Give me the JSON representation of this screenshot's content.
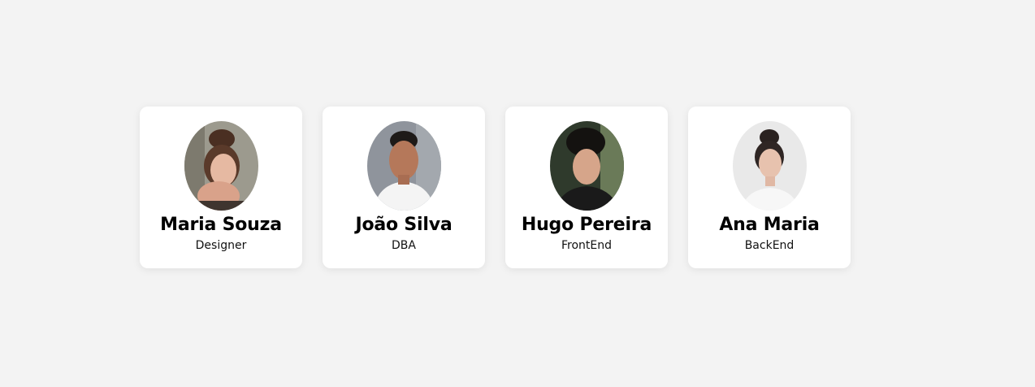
{
  "people": [
    {
      "name": "Maria Souza",
      "role": "Designer"
    },
    {
      "name": "João Silva",
      "role": "DBA"
    },
    {
      "name": "Hugo Pereira",
      "role": "FrontEnd"
    },
    {
      "name": "Ana Maria",
      "role": "BackEnd"
    }
  ],
  "colors": {
    "background": "#f3f3f3",
    "card": "#ffffff"
  }
}
